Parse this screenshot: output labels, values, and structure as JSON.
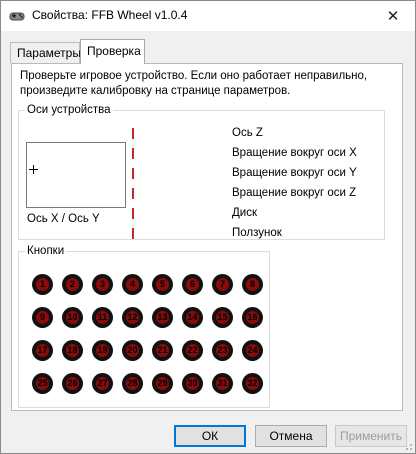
{
  "window": {
    "title": "Свойства: FFB Wheel v1.0.4"
  },
  "tabs": [
    {
      "label": "Параметры",
      "active": false
    },
    {
      "label": "Проверка",
      "active": true
    }
  ],
  "description": "Проверьте игровое устройство. Если оно работает неправильно, произведите калибровку на странице параметров.",
  "axes_group": {
    "legend": "Оси устройства",
    "xy_caption": "Ось X / Ось Y",
    "axes": [
      "Ось Z",
      "Вращение вокруг оси X",
      "Вращение вокруг оси Y",
      "Вращение вокруг оси Z",
      "Диск",
      "Ползунок"
    ]
  },
  "buttons_group": {
    "legend": "Кнопки",
    "buttons": [
      "1",
      "2",
      "3",
      "4",
      "5",
      "6",
      "7",
      "8",
      "9",
      "10",
      "11",
      "12",
      "13",
      "14",
      "15",
      "16",
      "17",
      "18",
      "19",
      "20",
      "21",
      "22",
      "23",
      "24",
      "25",
      "26",
      "27",
      "28",
      "29",
      "30",
      "31",
      "32"
    ],
    "active_color": "#8b0a0a"
  },
  "footer": {
    "ok": "ОК",
    "cancel": "Отмена",
    "apply": "Применить"
  },
  "colors": {
    "axis_indicator": "#c1272d",
    "focus": "#0078d7"
  }
}
